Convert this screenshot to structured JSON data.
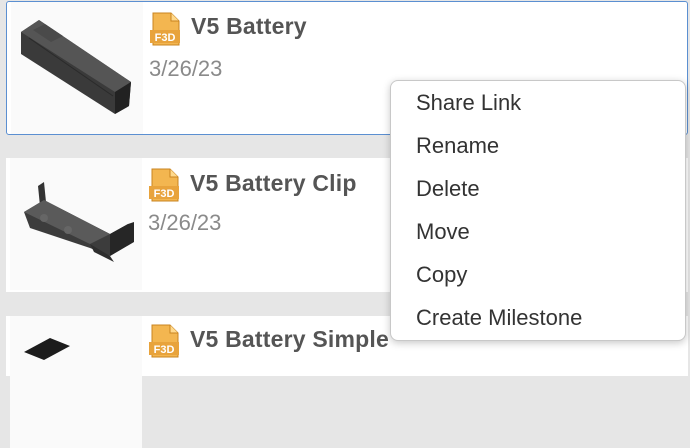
{
  "files": [
    {
      "name": "V5 Battery",
      "date": "3/26/23",
      "type_badge": "F3D",
      "selected": true
    },
    {
      "name": "V5 Battery Clip",
      "date": "3/26/23",
      "type_badge": "F3D",
      "selected": false
    },
    {
      "name": "V5 Battery Simple",
      "date": "",
      "type_badge": "F3D",
      "selected": false
    }
  ],
  "context_menu": {
    "items": [
      {
        "label": "Share Link"
      },
      {
        "label": "Rename"
      },
      {
        "label": "Delete"
      },
      {
        "label": "Move"
      },
      {
        "label": "Copy"
      },
      {
        "label": "Create Milestone"
      }
    ]
  },
  "colors": {
    "selection_border": "#5b8fd1",
    "badge_orange": "#e8a33c",
    "title_text": "#555555",
    "date_text": "#8a8a8a"
  },
  "icons": {
    "file_type": "f3d-file-icon"
  }
}
